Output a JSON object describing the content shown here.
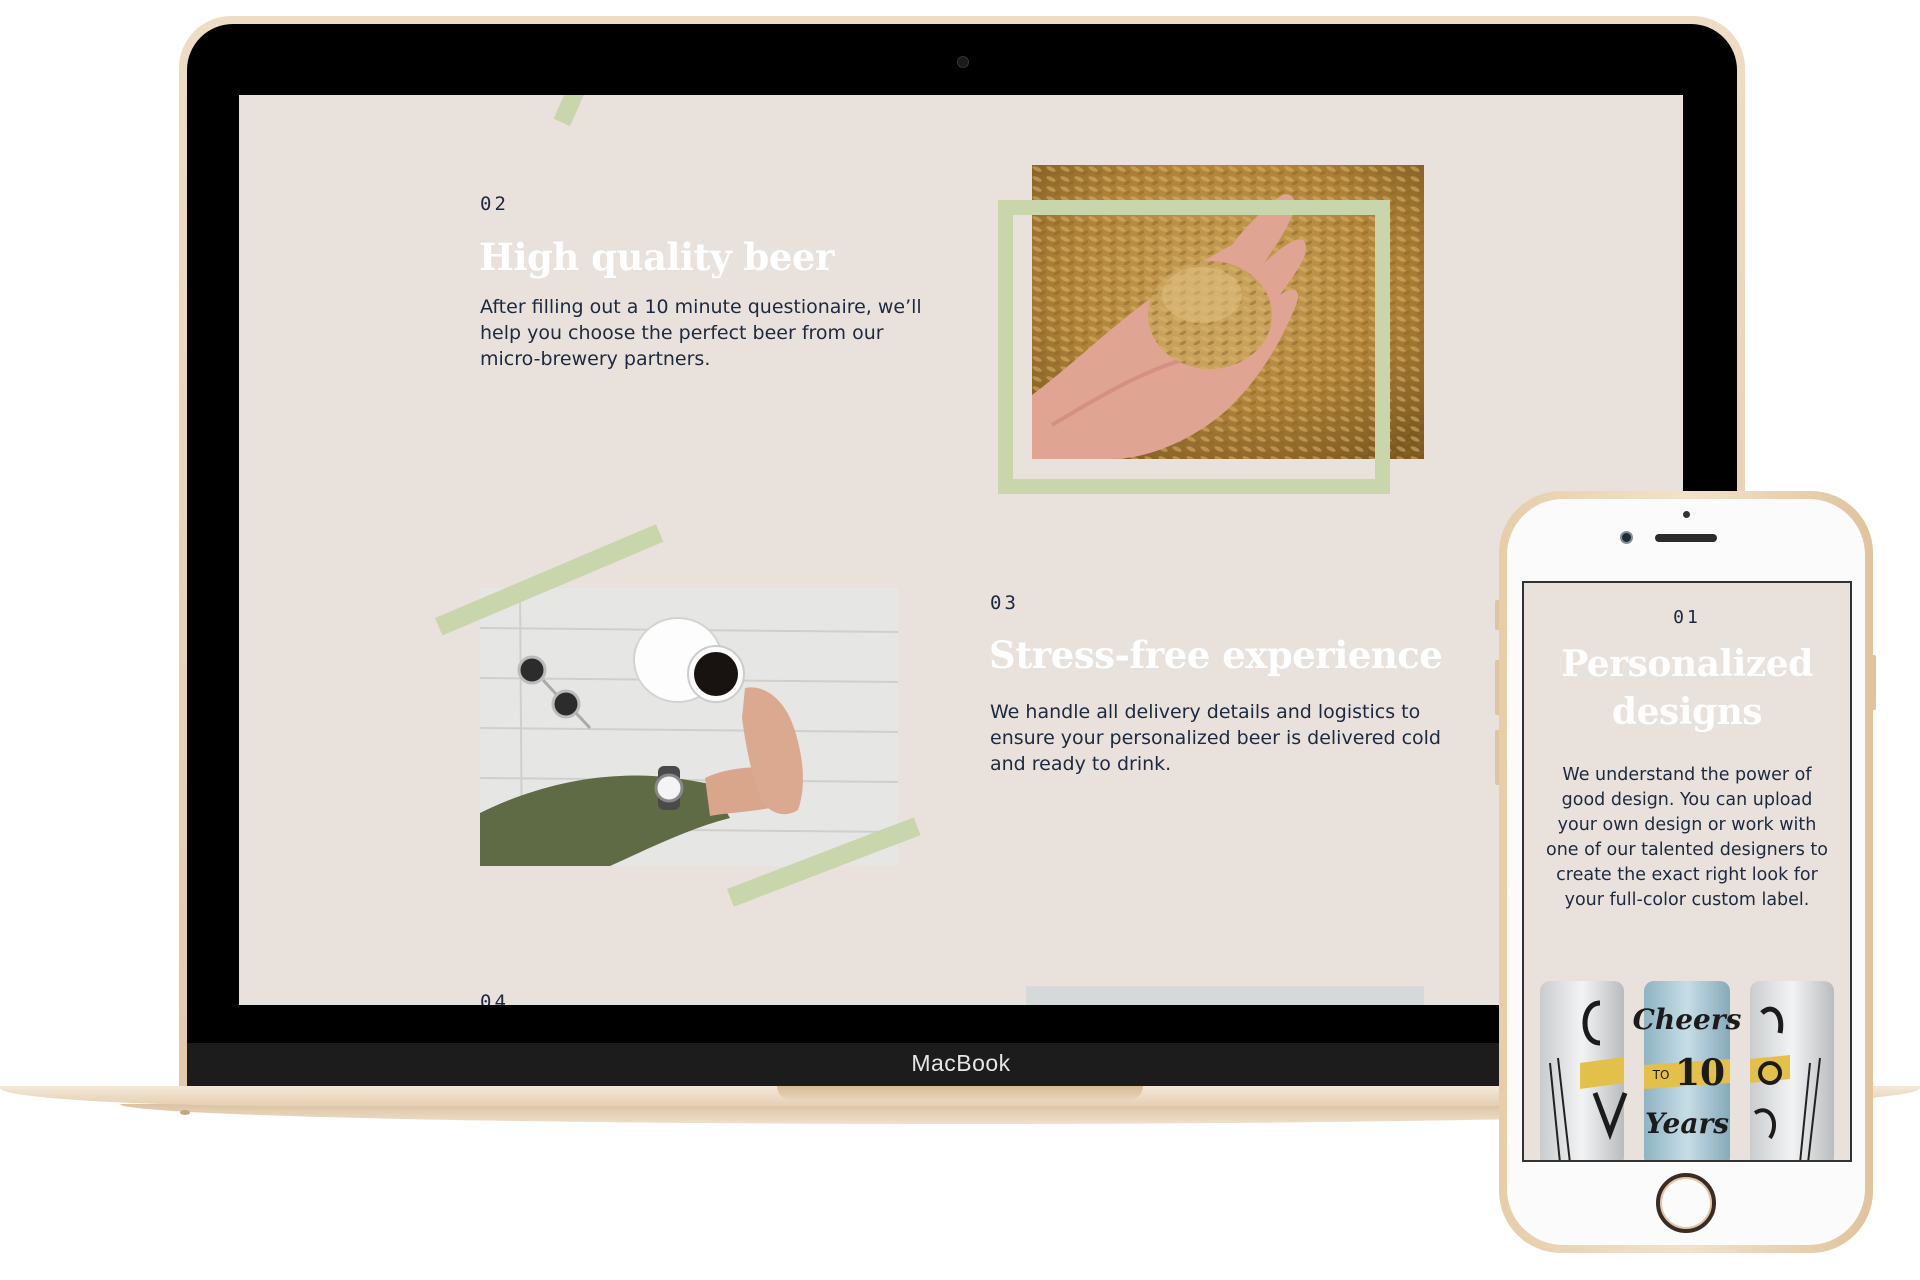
{
  "laptop": {
    "brand": "MacBook",
    "sections": [
      {
        "number": "02",
        "title": "High quality beer",
        "body": "After filling out a 10 minute questionaire, we’ll help you choose the perfect beer from our micro-brewery partners."
      },
      {
        "number": "03",
        "title": "Stress-free experience",
        "body": "We handle all delivery details and logistics to ensure your personalized beer is delivered cold and ready to drink."
      },
      {
        "number": "04"
      }
    ]
  },
  "phone": {
    "section": {
      "number": "01",
      "title_line1": "Personalized",
      "title_line2": "designs",
      "body": "We understand the power of good design. You can upload your own design or work with one of our talented designers to create the exact right look for your full-color custom label."
    },
    "cans": {
      "text_cheers": "Cheers",
      "text_to": "TO",
      "text_ten": "10",
      "text_years": "Years"
    }
  },
  "colors": {
    "screen_bg": "#e8e1dc",
    "tape_green": "#c9d6ab",
    "text_navy": "#1c2a3f",
    "gold": "#e3c9a9"
  }
}
